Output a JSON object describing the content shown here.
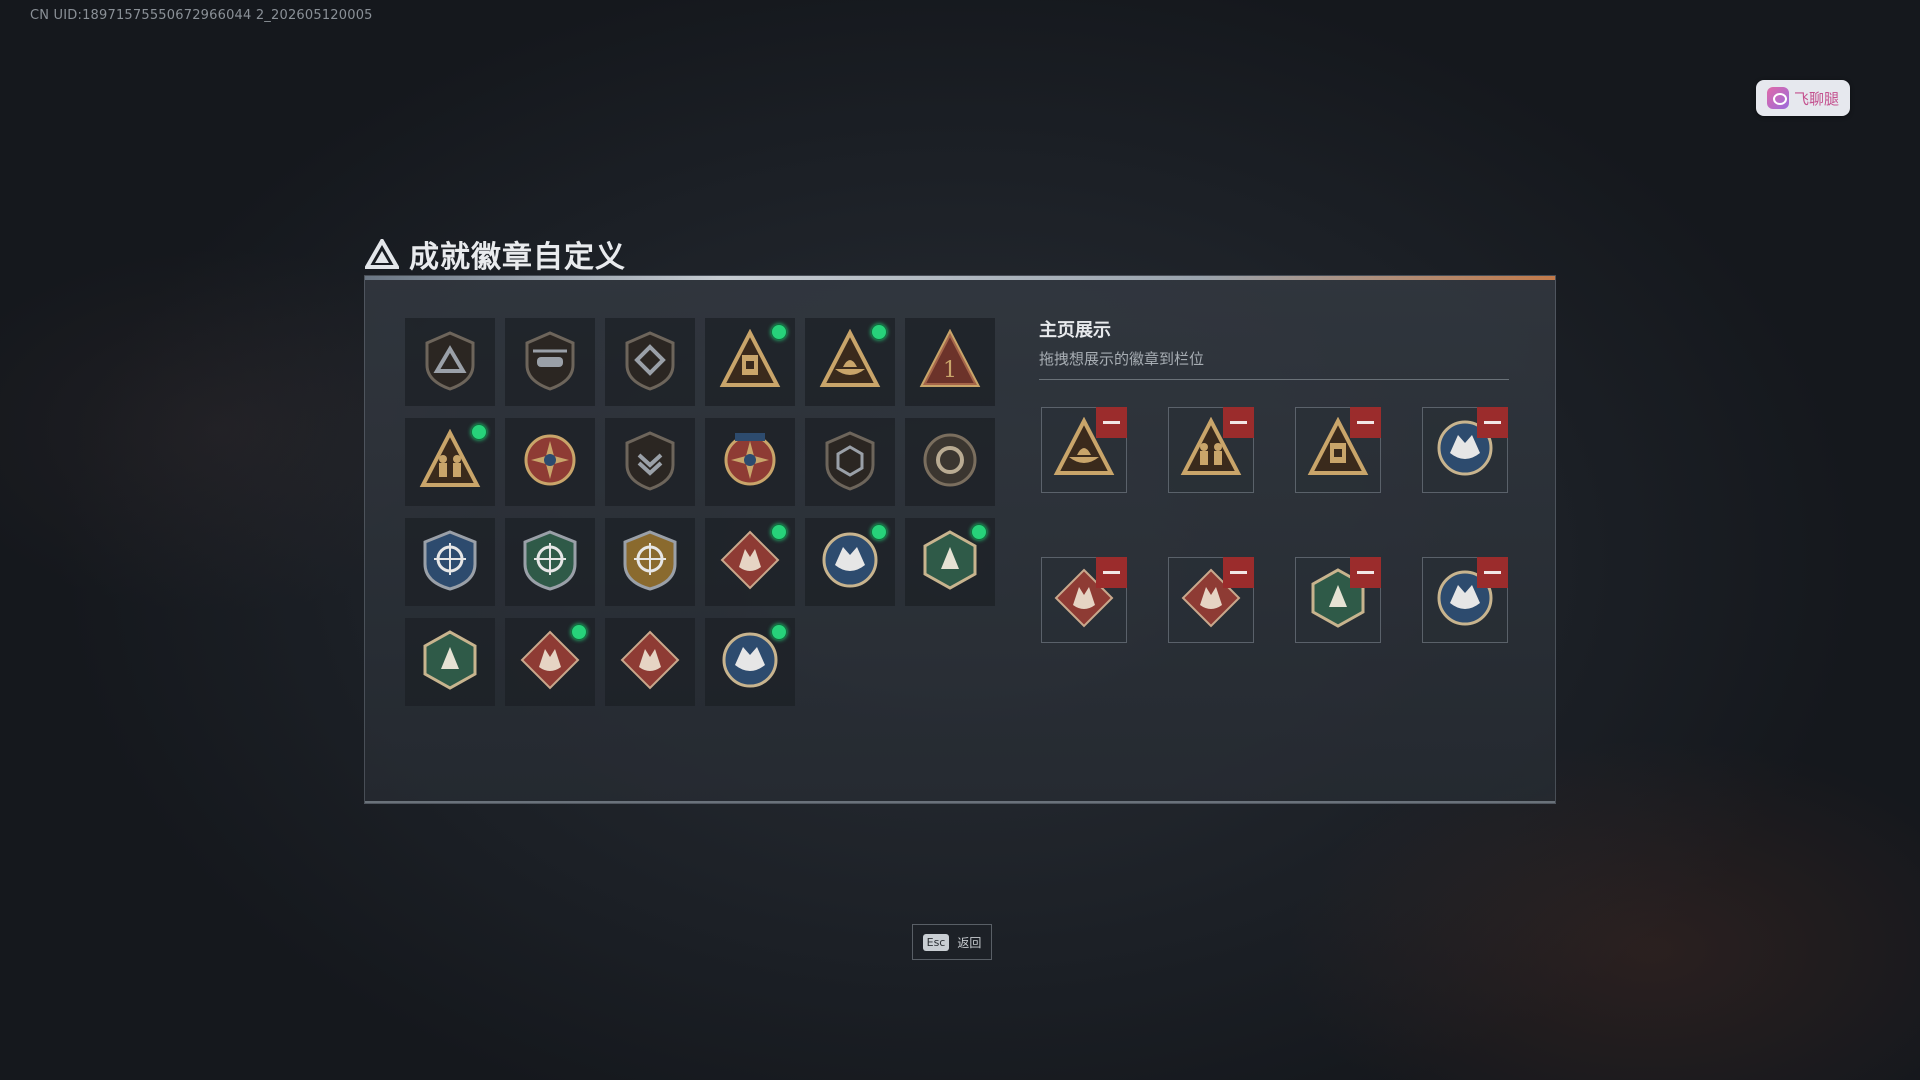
{
  "uid_text": "CN UID:18971575550672966044 2_202605120005",
  "chat_chip": {
    "label": "飞聊腿"
  },
  "title": "成就徽章自定义",
  "display": {
    "title": "主页展示",
    "subtitle": "拖拽想展示的徽章到栏位"
  },
  "colors": {
    "accent_green": "#27d27a",
    "remove_red": "#9b2c2c"
  },
  "badges": [
    {
      "icon": "triangle-shield-badge-icon",
      "new": false
    },
    {
      "icon": "helicopter-shield-badge-icon",
      "new": false
    },
    {
      "icon": "diamond-shield-badge-icon",
      "new": false
    },
    {
      "icon": "gold-triangle-tower-badge-icon",
      "new": true
    },
    {
      "icon": "gold-triangle-boat-badge-icon",
      "new": true
    },
    {
      "icon": "gold-triangle-number-one-badge-icon",
      "new": false
    },
    {
      "icon": "gold-triangle-soldiers-badge-icon",
      "new": true
    },
    {
      "icon": "compass-star-badge-icon",
      "new": false
    },
    {
      "icon": "shield-chevron-badge-icon",
      "new": false
    },
    {
      "icon": "crest-stars-badge-icon",
      "new": false
    },
    {
      "icon": "hexagon-shield-badge-icon",
      "new": false
    },
    {
      "icon": "round-emblem-badge-icon",
      "new": false
    },
    {
      "icon": "blue-crosshair-shield-badge-icon",
      "new": false
    },
    {
      "icon": "green-crosshair-shield-badge-icon",
      "new": false
    },
    {
      "icon": "gold-crosshair-shield-badge-icon",
      "new": false
    },
    {
      "icon": "red-diamond-wolf-badge-icon",
      "new": true
    },
    {
      "icon": "blue-circle-eagle-badge-icon",
      "new": true
    },
    {
      "icon": "green-hexagon-wasp-badge-icon",
      "new": true
    },
    {
      "icon": "green-hexagon-figure-badge-icon",
      "new": false
    },
    {
      "icon": "red-diamond-dragon-badge-icon",
      "new": true
    },
    {
      "icon": "red-diamond-runner-badge-icon",
      "new": false
    },
    {
      "icon": "blue-circle-wolf-badge-icon",
      "new": true
    }
  ],
  "slots": [
    {
      "icon": "gold-triangle-boat-badge-icon"
    },
    {
      "icon": "gold-triangle-soldiers-badge-icon"
    },
    {
      "icon": "gold-triangle-tower-badge-icon"
    },
    {
      "icon": "blue-circle-wolf-badge-icon"
    },
    {
      "icon": "red-diamond-wolf-badge-icon"
    },
    {
      "icon": "red-diamond-dragon-badge-icon"
    },
    {
      "icon": "green-hexagon-wasp-badge-icon"
    },
    {
      "icon": "blue-circle-eagle-badge-icon"
    }
  ],
  "esc": {
    "key": "Esc",
    "label": "返回"
  }
}
